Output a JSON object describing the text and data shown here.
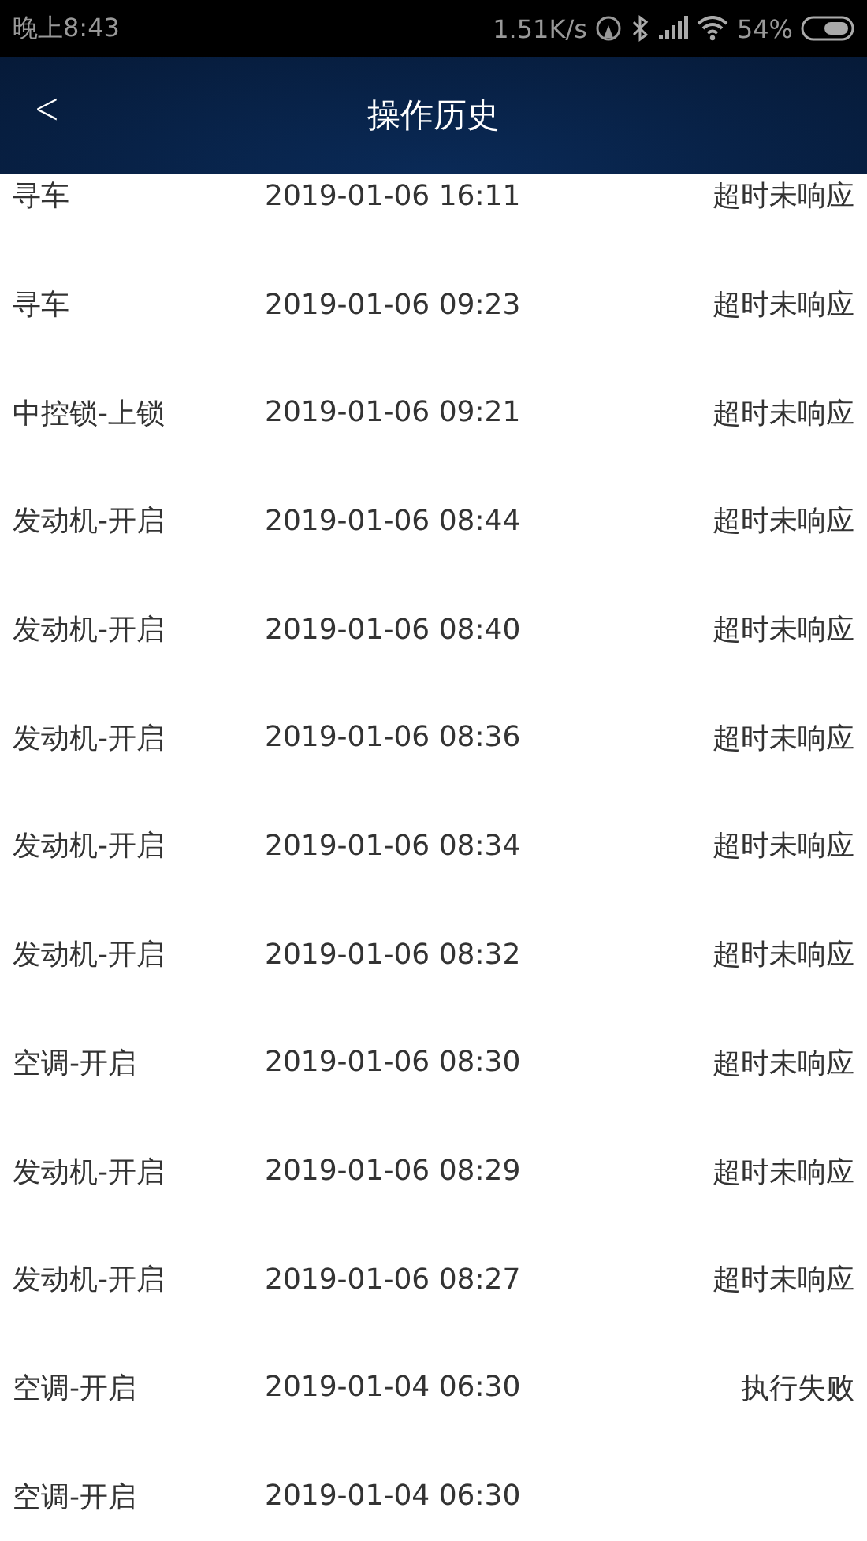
{
  "status_bar": {
    "time": "晚上8:43",
    "speed": "1.51K/s",
    "battery": "54%"
  },
  "header": {
    "back": "<",
    "title": "操作历史"
  },
  "rows": [
    {
      "action": "寻车",
      "time": "2019-01-06 16:11",
      "status": "超时未响应"
    },
    {
      "action": "寻车",
      "time": "2019-01-06 09:23",
      "status": "超时未响应"
    },
    {
      "action": "中控锁-上锁",
      "time": "2019-01-06 09:21",
      "status": "超时未响应"
    },
    {
      "action": "发动机-开启",
      "time": "2019-01-06 08:44",
      "status": "超时未响应"
    },
    {
      "action": "发动机-开启",
      "time": "2019-01-06 08:40",
      "status": "超时未响应"
    },
    {
      "action": "发动机-开启",
      "time": "2019-01-06 08:36",
      "status": "超时未响应"
    },
    {
      "action": "发动机-开启",
      "time": "2019-01-06 08:34",
      "status": "超时未响应"
    },
    {
      "action": "发动机-开启",
      "time": "2019-01-06 08:32",
      "status": "超时未响应"
    },
    {
      "action": "空调-开启",
      "time": "2019-01-06 08:30",
      "status": "超时未响应"
    },
    {
      "action": "发动机-开启",
      "time": "2019-01-06 08:29",
      "status": "超时未响应"
    },
    {
      "action": "发动机-开启",
      "time": "2019-01-06 08:27",
      "status": "超时未响应"
    },
    {
      "action": "空调-开启",
      "time": "2019-01-04 06:30",
      "status": "执行失败"
    },
    {
      "action": "空调-开启",
      "time": "2019-01-04 06:30"
    }
  ]
}
